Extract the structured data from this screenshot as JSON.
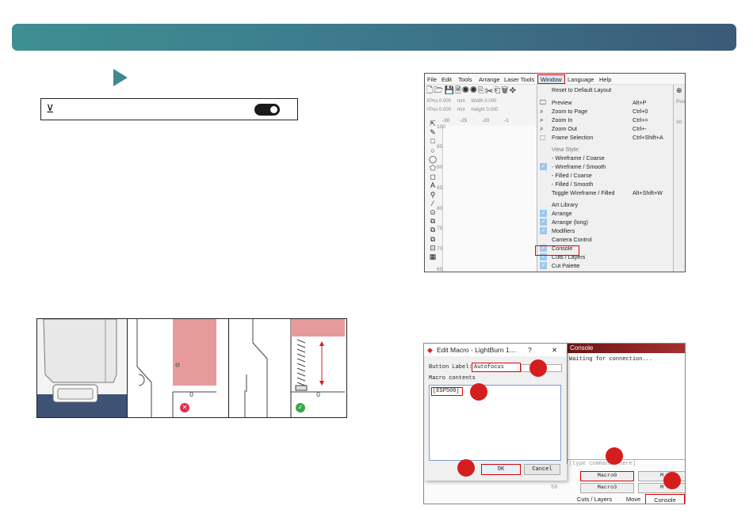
{
  "colors": {
    "banner_start": "#3f8f92",
    "banner_end": "#3b5a78",
    "play": "#3e8a8e",
    "highlight": "#d00000",
    "marker": "#d41e1e",
    "error": "#e0304e",
    "ok": "#3aa84a"
  },
  "toggle": {
    "icon": "laser-icon",
    "state": "on"
  },
  "lightburn": {
    "menu": [
      "File",
      "Edit",
      "Tools",
      "Arrange",
      "Laser Tools",
      "Window",
      "Language",
      "Help"
    ],
    "toolbar_icons": "🗋🗁💾🗎◉◉⎘✂⎗🗑✥",
    "coords": {
      "xpos": "XPos 0.000",
      "ypos": "YPos 0.000",
      "unit1": "mm",
      "unit2": "mm",
      "width": "Width 0.000",
      "height": "Height 0.000"
    },
    "ruler_top": [
      "-30",
      "-25",
      "-20",
      "-1"
    ],
    "ruler_left": [
      "100",
      "95",
      "90",
      "85",
      "80",
      "75",
      "70",
      "65"
    ],
    "right_hint": "Pos",
    "right_num": "30",
    "left_tools": [
      "⇱",
      "✎",
      "□",
      "○",
      "◯",
      "⬠",
      "◻",
      "A",
      "⚲",
      "⁄",
      "⊙",
      "⧉",
      "⧉",
      "⧉",
      "⊡",
      "▦"
    ],
    "window_menu": {
      "reset": "Reset to Default Layout",
      "preview": {
        "label": "Preview",
        "shortcut": "Alt+P"
      },
      "zoom_page": {
        "label": "Zoom to Page",
        "shortcut": "Ctrl+0"
      },
      "zoom_in": {
        "label": "Zoom In",
        "shortcut": "Ctrl+="
      },
      "zoom_out": {
        "label": "Zoom Out",
        "shortcut": "Ctrl+-"
      },
      "frame": {
        "label": "Frame Selection",
        "shortcut": "Ctrl+Shift+A"
      },
      "view_style": "View Style:",
      "wire_coarse": "- Wireframe / Coarse",
      "wire_smooth": "- Wireframe / Smooth",
      "filled_coarse": "- Filled / Coarse",
      "filled_smooth": "- Filled / Smooth",
      "toggle_wire": {
        "label": "Toggle Wireframe / Filled",
        "shortcut": "Alt+Shift+W"
      },
      "art_library": "Art Library",
      "arrange": "Arrange",
      "arrange_long": "Arrange (long)",
      "modifiers": "Modifiers",
      "camera": "Camera Control",
      "console": "Console",
      "cuts_layers": "Cuts / Layers",
      "cut_palette": "Cut Palette"
    }
  },
  "macro": {
    "title": "Edit Macro - LightBurn 1....",
    "help": "?",
    "close": "✕",
    "button_label_caption": "Button Label:",
    "button_label_value": "Autofocus",
    "contents_caption": "Macro contents",
    "contents_value": "[ESP500]",
    "ok": "OK",
    "cancel": "Cancel",
    "console_title": "Console",
    "console_text": "Waiting for connection...",
    "console_input_placeholder": "(type commands here)",
    "macro0": "Macro0",
    "macro1": "M",
    "macro3": "Macro3",
    "macro4": "M",
    "ruler_num": "50",
    "tab_cuts": "Cuts / Layers",
    "tab_move": "Move",
    "tab_console": "Console"
  }
}
